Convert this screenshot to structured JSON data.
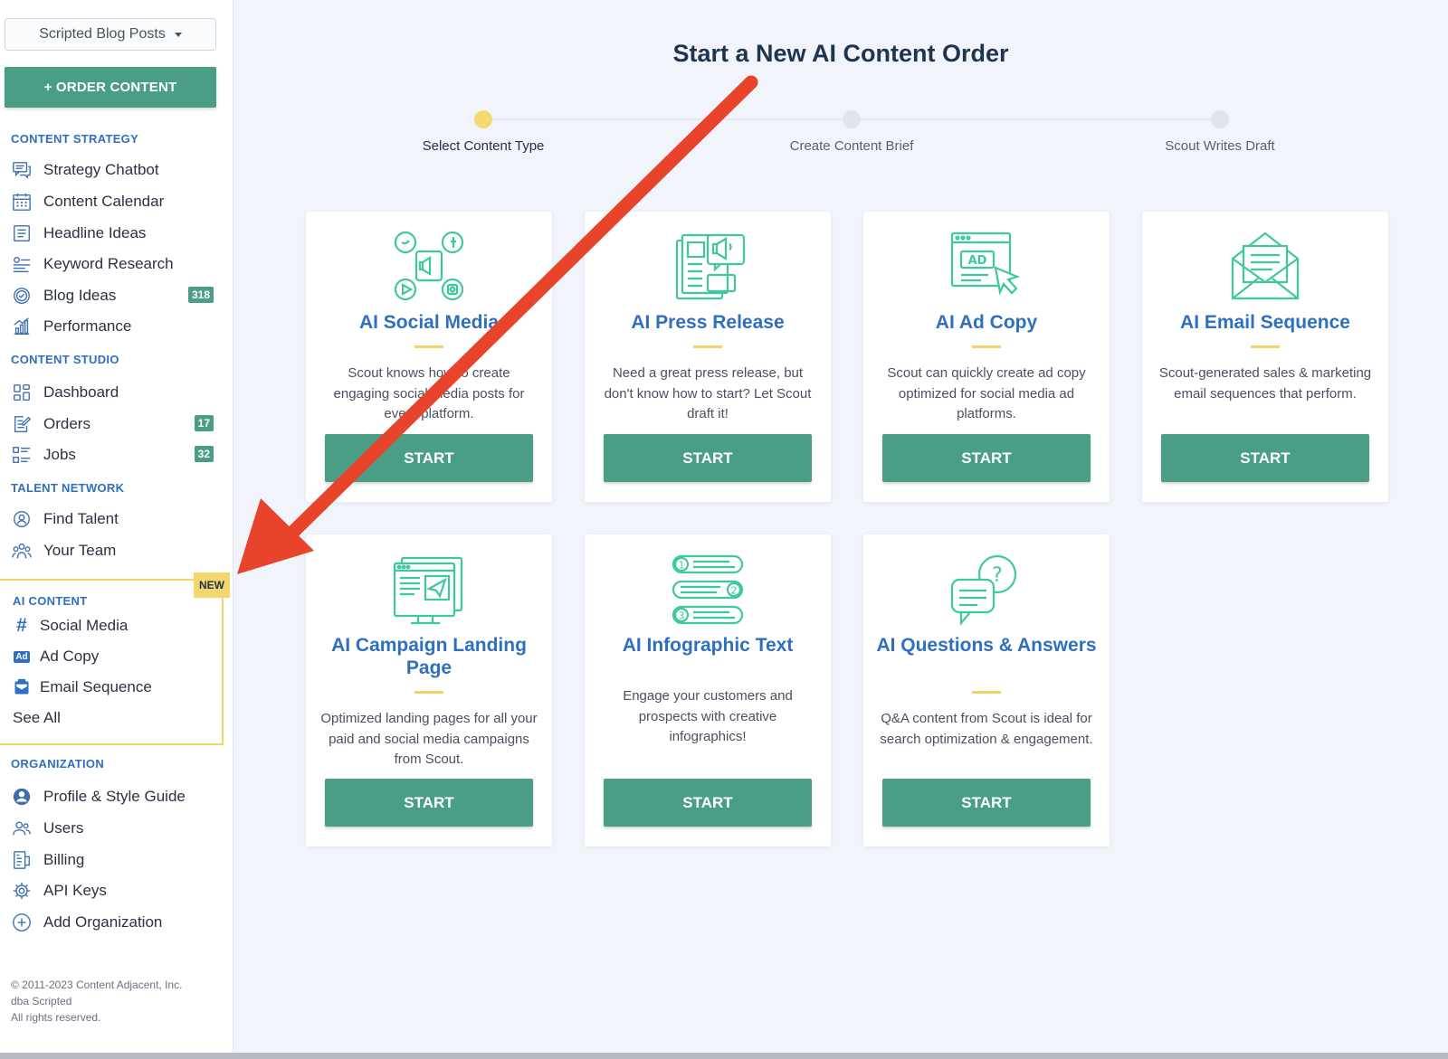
{
  "sidebar": {
    "workspace": "Scripted Blog Posts",
    "order_button": "+ ORDER CONTENT",
    "sections": {
      "content_strategy": "CONTENT STRATEGY",
      "content_studio": "CONTENT STUDIO",
      "talent_network": "TALENT NETWORK",
      "ai_content": "AI CONTENT",
      "organization": "ORGANIZATION"
    },
    "strategy_items": [
      {
        "label": "Strategy Chatbot",
        "icon": "chat-icon"
      },
      {
        "label": "Content Calendar",
        "icon": "calendar-icon"
      },
      {
        "label": "Headline Ideas",
        "icon": "list-icon"
      },
      {
        "label": "Keyword Research",
        "icon": "keyword-icon"
      },
      {
        "label": "Blog Ideas",
        "icon": "badge-check-icon",
        "badge": "318"
      },
      {
        "label": "Performance",
        "icon": "bar-chart-icon"
      }
    ],
    "studio_items": [
      {
        "label": "Dashboard",
        "icon": "grid-icon"
      },
      {
        "label": "Orders",
        "icon": "edit-doc-icon",
        "badge": "17"
      },
      {
        "label": "Jobs",
        "icon": "jobs-list-icon",
        "badge": "32"
      }
    ],
    "talent_items": [
      {
        "label": "Find Talent",
        "icon": "search-person-icon"
      },
      {
        "label": "Your Team",
        "icon": "team-icon"
      }
    ],
    "new_tag": "NEW",
    "ai_items": [
      {
        "label": "Social Media",
        "icon": "hashtag-icon"
      },
      {
        "label": "Ad Copy",
        "icon": "ad-icon",
        "icon_text": "Ad"
      },
      {
        "label": "Email Sequence",
        "icon": "email-icon"
      },
      {
        "label": "See All"
      }
    ],
    "org_items": [
      {
        "label": "Profile & Style Guide",
        "icon": "profile-icon"
      },
      {
        "label": "Users",
        "icon": "users-icon"
      },
      {
        "label": "Billing",
        "icon": "billing-icon"
      },
      {
        "label": "API Keys",
        "icon": "gear-icon"
      },
      {
        "label": "Add Organization",
        "icon": "plus-circle-icon"
      }
    ],
    "footer": {
      "line1": "© 2011-2023 Content Adjacent, Inc.",
      "line2": "dba Scripted",
      "line3": "All rights reserved."
    }
  },
  "main": {
    "title": "Start a New AI Content Order",
    "steps": [
      {
        "label": "Select Content Type",
        "active": true
      },
      {
        "label": "Create Content Brief",
        "active": false
      },
      {
        "label": "Scout Writes Draft",
        "active": false
      }
    ],
    "cards": [
      {
        "title": "AI Social Media",
        "desc": "Scout knows how to create engaging social media posts for every platform.",
        "button": "START",
        "icon": "social-media-icon"
      },
      {
        "title": "AI Press Release",
        "desc": "Need a great press release, but don't know how to start? Let Scout draft it!",
        "button": "START",
        "icon": "press-release-icon"
      },
      {
        "title": "AI Ad Copy",
        "desc": "Scout can quickly create ad copy optimized for social media ad platforms.",
        "button": "START",
        "icon": "ad-copy-icon",
        "icon_text": "AD"
      },
      {
        "title": "AI Email Sequence",
        "desc": "Scout-generated sales & marketing email sequences that perform.",
        "button": "START",
        "icon": "email-sequence-icon"
      },
      {
        "title": "AI Campaign Landing Page",
        "desc": "Optimized landing pages for all your paid and social media campaigns from Scout.",
        "button": "START",
        "icon": "landing-page-icon"
      },
      {
        "title": "AI Infographic Text",
        "desc": "Engage your customers and prospects with creative infographics!",
        "button": "START",
        "icon": "infographic-icon",
        "icon_numbers": [
          "1",
          "2",
          "3"
        ]
      },
      {
        "title": "AI Questions & Answers",
        "desc": "Q&A content from Scout is ideal for search optimization & engagement.",
        "button": "START",
        "icon": "qa-icon",
        "icon_text": "?"
      }
    ]
  },
  "colors": {
    "accent_green": "#4a9e85",
    "link_blue": "#2f6fc0",
    "highlight_yellow": "#f3d26a",
    "annotation_red": "#e8432b",
    "icon_teal": "#3fc8a0"
  }
}
